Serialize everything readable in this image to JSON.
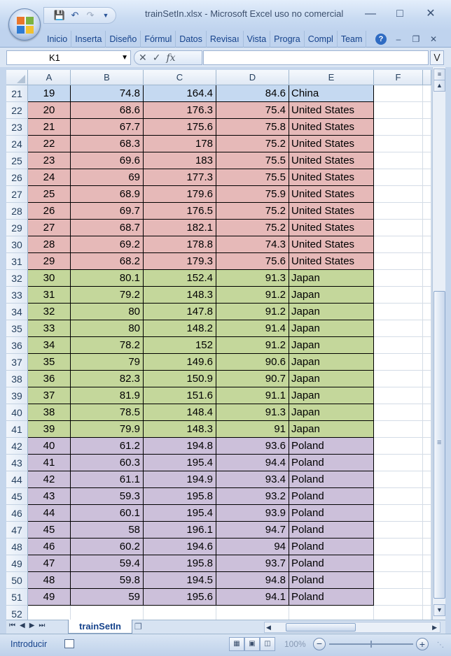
{
  "window": {
    "title": "trainSetIn.xlsx - Microsoft Excel uso no comercial"
  },
  "ribbon": {
    "tabs": [
      "Inicio",
      "Inserta",
      "Diseño",
      "Fórmul",
      "Datos",
      "Revisaı",
      "Vista",
      "Progra",
      "Compl",
      "Team"
    ]
  },
  "formula_bar": {
    "name_box": "K1",
    "fx": "fx",
    "formula": ""
  },
  "columns": [
    "A",
    "B",
    "C",
    "D",
    "E",
    "F"
  ],
  "colors": {
    "China": "#c5d9f1",
    "United States": "#e6b9b8",
    "Japan": "#c4d79b",
    "Poland": "#ccc0da"
  },
  "rows": [
    {
      "n": "21",
      "cells": [
        "19",
        "74.8",
        "164.4",
        "84.6",
        "China"
      ]
    },
    {
      "n": "22",
      "cells": [
        "20",
        "68.6",
        "176.3",
        "75.4",
        "United States"
      ]
    },
    {
      "n": "23",
      "cells": [
        "21",
        "67.7",
        "175.6",
        "75.8",
        "United States"
      ]
    },
    {
      "n": "24",
      "cells": [
        "22",
        "68.3",
        "178",
        "75.2",
        "United States"
      ]
    },
    {
      "n": "25",
      "cells": [
        "23",
        "69.6",
        "183",
        "75.5",
        "United States"
      ]
    },
    {
      "n": "26",
      "cells": [
        "24",
        "69",
        "177.3",
        "75.5",
        "United States"
      ]
    },
    {
      "n": "27",
      "cells": [
        "25",
        "68.9",
        "179.6",
        "75.9",
        "United States"
      ]
    },
    {
      "n": "28",
      "cells": [
        "26",
        "69.7",
        "176.5",
        "75.2",
        "United States"
      ]
    },
    {
      "n": "29",
      "cells": [
        "27",
        "68.7",
        "182.1",
        "75.2",
        "United States"
      ]
    },
    {
      "n": "30",
      "cells": [
        "28",
        "69.2",
        "178.8",
        "74.3",
        "United States"
      ]
    },
    {
      "n": "31",
      "cells": [
        "29",
        "68.2",
        "179.3",
        "75.6",
        "United States"
      ]
    },
    {
      "n": "32",
      "cells": [
        "30",
        "80.1",
        "152.4",
        "91.3",
        "Japan"
      ]
    },
    {
      "n": "33",
      "cells": [
        "31",
        "79.2",
        "148.3",
        "91.2",
        "Japan"
      ]
    },
    {
      "n": "34",
      "cells": [
        "32",
        "80",
        "147.8",
        "91.2",
        "Japan"
      ]
    },
    {
      "n": "35",
      "cells": [
        "33",
        "80",
        "148.2",
        "91.4",
        "Japan"
      ]
    },
    {
      "n": "36",
      "cells": [
        "34",
        "78.2",
        "152",
        "91.2",
        "Japan"
      ]
    },
    {
      "n": "37",
      "cells": [
        "35",
        "79",
        "149.6",
        "90.6",
        "Japan"
      ]
    },
    {
      "n": "38",
      "cells": [
        "36",
        "82.3",
        "150.9",
        "90.7",
        "Japan"
      ]
    },
    {
      "n": "39",
      "cells": [
        "37",
        "81.9",
        "151.6",
        "91.1",
        "Japan"
      ]
    },
    {
      "n": "40",
      "cells": [
        "38",
        "78.5",
        "148.4",
        "91.3",
        "Japan"
      ]
    },
    {
      "n": "41",
      "cells": [
        "39",
        "79.9",
        "148.3",
        "91",
        "Japan"
      ]
    },
    {
      "n": "42",
      "cells": [
        "40",
        "61.2",
        "194.8",
        "93.6",
        "Poland"
      ]
    },
    {
      "n": "43",
      "cells": [
        "41",
        "60.3",
        "195.4",
        "94.4",
        "Poland"
      ]
    },
    {
      "n": "44",
      "cells": [
        "42",
        "61.1",
        "194.9",
        "93.4",
        "Poland"
      ]
    },
    {
      "n": "45",
      "cells": [
        "43",
        "59.3",
        "195.8",
        "93.2",
        "Poland"
      ]
    },
    {
      "n": "46",
      "cells": [
        "44",
        "60.1",
        "195.4",
        "93.9",
        "Poland"
      ]
    },
    {
      "n": "47",
      "cells": [
        "45",
        "58",
        "196.1",
        "94.7",
        "Poland"
      ]
    },
    {
      "n": "48",
      "cells": [
        "46",
        "60.2",
        "194.6",
        "94",
        "Poland"
      ]
    },
    {
      "n": "49",
      "cells": [
        "47",
        "59.4",
        "195.8",
        "93.7",
        "Poland"
      ]
    },
    {
      "n": "50",
      "cells": [
        "48",
        "59.8",
        "194.5",
        "94.8",
        "Poland"
      ]
    },
    {
      "n": "51",
      "cells": [
        "49",
        "59",
        "195.6",
        "94.1",
        "Poland"
      ]
    },
    {
      "n": "52",
      "cells": []
    }
  ],
  "sheet_tabs": {
    "active": "trainSetIn"
  },
  "status_bar": {
    "mode": "Introducir",
    "zoom": "100%"
  }
}
